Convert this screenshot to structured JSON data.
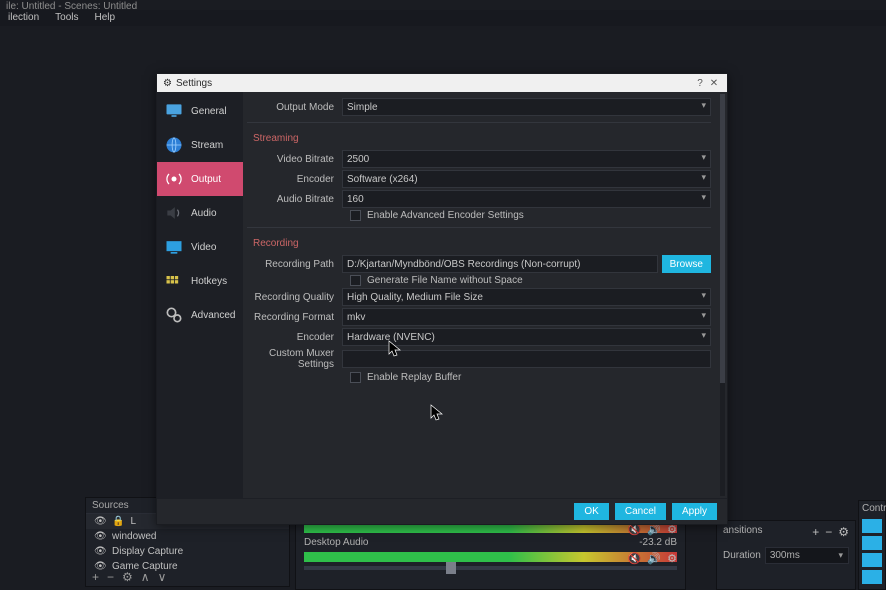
{
  "window": {
    "title": "ile: Untitled - Scenes: Untitled"
  },
  "menu": {
    "items": [
      "ilection",
      "Tools",
      "Help"
    ]
  },
  "dialog": {
    "title": "Settings",
    "help": "?",
    "close": "✕",
    "sidebar": {
      "items": [
        {
          "label": "General"
        },
        {
          "label": "Stream"
        },
        {
          "label": "Output"
        },
        {
          "label": "Audio"
        },
        {
          "label": "Video"
        },
        {
          "label": "Hotkeys"
        },
        {
          "label": "Advanced"
        }
      ]
    },
    "output": {
      "mode_label": "Output Mode",
      "mode_value": "Simple"
    },
    "streaming": {
      "title": "Streaming",
      "video_bitrate_label": "Video Bitrate",
      "video_bitrate_value": "2500",
      "encoder_label": "Encoder",
      "encoder_value": "Software (x264)",
      "audio_bitrate_label": "Audio Bitrate",
      "audio_bitrate_value": "160",
      "advanced_chk": "Enable Advanced Encoder Settings"
    },
    "recording": {
      "title": "Recording",
      "path_label": "Recording Path",
      "path_value": "D:/Kjartan/Myndbönd/OBS Recordings (Non-corrupt)",
      "browse": "Browse",
      "gen_chk": "Generate File Name without Space",
      "quality_label": "Recording Quality",
      "quality_value": "High Quality, Medium File Size",
      "format_label": "Recording Format",
      "format_value": "mkv",
      "encoder_label": "Encoder",
      "encoder_value": "Hardware (NVENC)",
      "muxer_label": "Custom Muxer Settings",
      "muxer_value": "",
      "replay_chk": "Enable Replay Buffer"
    },
    "buttons": {
      "ok": "OK",
      "cancel": "Cancel",
      "apply": "Apply"
    }
  },
  "sources": {
    "header": "Sources",
    "items": [
      {
        "label": "L"
      },
      {
        "label": "windowed"
      },
      {
        "label": "Display Capture"
      },
      {
        "label": "Game Capture"
      }
    ],
    "foot_icons": [
      "+",
      "−",
      "⚙",
      "∧",
      "∨"
    ]
  },
  "mixer": {
    "track1": "Desktop Audio",
    "readout": "-23.2 dB",
    "icons": [
      "🔇",
      "🔊",
      "⚙"
    ]
  },
  "transitions": {
    "header": "ansitions",
    "duration_label": "Duration",
    "duration_value": "300ms",
    "head_icons": [
      "+",
      "−",
      "⚙"
    ]
  },
  "controls": {
    "header": "Contro"
  }
}
